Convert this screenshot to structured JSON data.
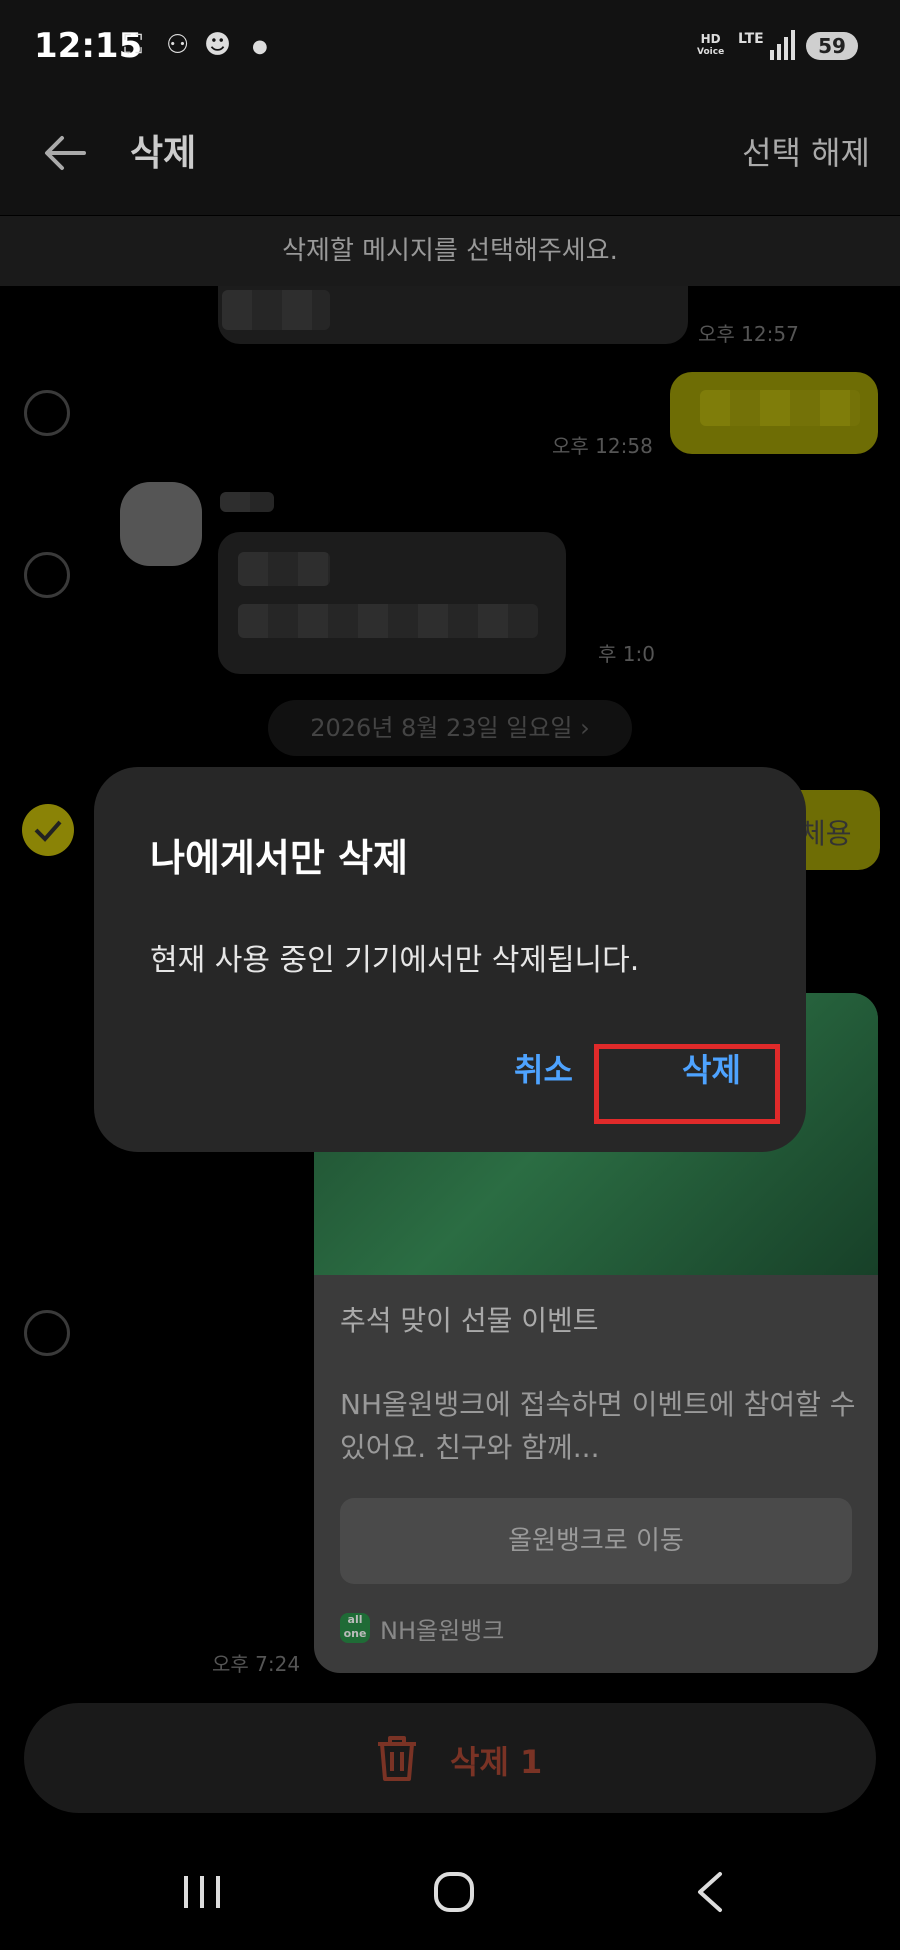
{
  "status_bar": {
    "time": "12:15",
    "hd_top": "HD",
    "hd_bottom": "Voice",
    "network": "LTE",
    "battery": "59"
  },
  "app_bar": {
    "title": "삭제",
    "deselect_label": "선택 해제"
  },
  "instruction": "삭제할 메시지를 선택해주세요.",
  "messages": [
    {
      "time": "오후 12:57"
    },
    {
      "time": "오후 12:58"
    },
    {
      "time": "후 1:0"
    }
  ],
  "date_separator": "2026년 8월 23일 일요일",
  "partial_text": "체용",
  "card": {
    "title": "추석 맞이 선물 이벤트",
    "description": "NH올원뱅크에 접속하면 이벤트에 참여할 수 있어요. 친구와 함께...",
    "button_label": "올원뱅크로 이동",
    "logo_top": "all",
    "logo_bottom": "one",
    "brand": "NH올원뱅크",
    "time": "오후 7:24"
  },
  "delete_bar": {
    "label": "삭제 1"
  },
  "dialog": {
    "title": "나에게서만 삭제",
    "message": "현재 사용 중인 기기에서만 삭제됩니다.",
    "cancel_label": "취소",
    "delete_label": "삭제"
  },
  "colors": {
    "accent_blue": "#4ea3ff",
    "highlight_red": "#e02a2a",
    "selection_yellow": "#8a8306"
  }
}
